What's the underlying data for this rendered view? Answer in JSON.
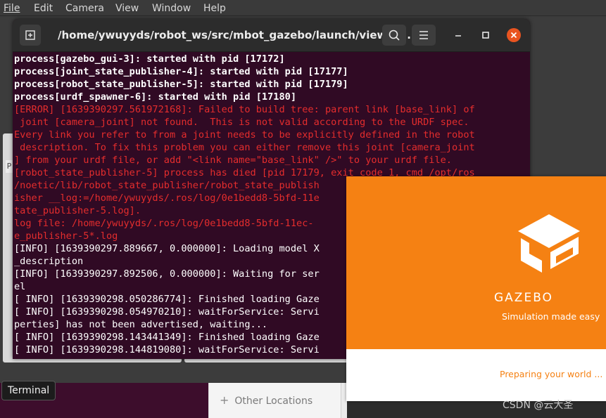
{
  "background_app": {
    "menu": [
      "File",
      "Edit",
      "Camera",
      "View",
      "Window",
      "Help"
    ],
    "panel_tab": "P"
  },
  "terminal": {
    "title": "/home/ywuyyds/robot_ws/src/mbot_gazebo/launch/view_m...",
    "lines": [
      {
        "text": "process[gazebo_gui-3]: started with pid [17172]",
        "style": "bold"
      },
      {
        "text": "process[joint_state_publisher-4]: started with pid [17177]",
        "style": "bold"
      },
      {
        "text": "process[robot_state_publisher-5]: started with pid [17179]",
        "style": "bold"
      },
      {
        "text": "process[urdf_spawner-6]: started with pid [17180]",
        "style": "bold"
      },
      {
        "text": "[ERROR] [1639390297.561972168]: Failed to build tree: parent link [base_link] of",
        "style": "err"
      },
      {
        "text": " joint [camera_joint] not found.  This is not valid according to the URDF spec.",
        "style": "err"
      },
      {
        "text": "Every link you refer to from a joint needs to be explicitly defined in the robot",
        "style": "err"
      },
      {
        "text": " description. To fix this problem you can either remove this joint [camera_joint",
        "style": "err"
      },
      {
        "text": "] from your urdf file, or add \"<link name=\"base_link\" />\" to your urdf file.",
        "style": "err"
      },
      {
        "text": "[robot_state_publisher-5] process has died [pid 17179, exit code 1, cmd /opt/ros",
        "style": "err"
      },
      {
        "text": "/noetic/lib/robot_state_publisher/robot_state_publish",
        "style": "err"
      },
      {
        "text": "isher __log:=/home/ywuyyds/.ros/log/0e1bedd8-5bfd-11e",
        "style": "err"
      },
      {
        "text": "tate_publisher-5.log].",
        "style": "err"
      },
      {
        "text": "log file: /home/ywuyyds/.ros/log/0e1bedd8-5bfd-11ec-",
        "style": "err"
      },
      {
        "text": "e_publisher-5*.log",
        "style": "err"
      },
      {
        "text": "[INFO] [1639390297.889667, 0.000000]: Loading model X",
        "style": "normal"
      },
      {
        "text": "_description",
        "style": "normal"
      },
      {
        "text": "[INFO] [1639390297.892506, 0.000000]: Waiting for ser",
        "style": "normal"
      },
      {
        "text": "el",
        "style": "normal"
      },
      {
        "text": "[ INFO] [1639390298.050286774]: Finished loading Gaze",
        "style": "normal"
      },
      {
        "text": "[ INFO] [1639390298.054970210]: waitForService: Servi",
        "style": "normal"
      },
      {
        "text": "perties] has not been advertised, waiting...",
        "style": "normal"
      },
      {
        "text": "[ INFO] [1639390298.143441349]: Finished loading Gaze",
        "style": "normal"
      },
      {
        "text": "[ INFO] [1639390298.144819080]: waitForService: Servi",
        "style": "normal"
      }
    ]
  },
  "splash": {
    "name": "GAZEBO",
    "tagline": "Simulation made easy",
    "status": "Preparing your world ...",
    "accent": "#f58113"
  },
  "taskbar": {
    "tooltip": "Terminal",
    "other_locations": "Other Locations"
  },
  "watermark": "CSDN @云大圣",
  "colors": {
    "terminal_bg": "#300a24",
    "error_text": "#e52d2d",
    "close_button": "#e95420"
  }
}
